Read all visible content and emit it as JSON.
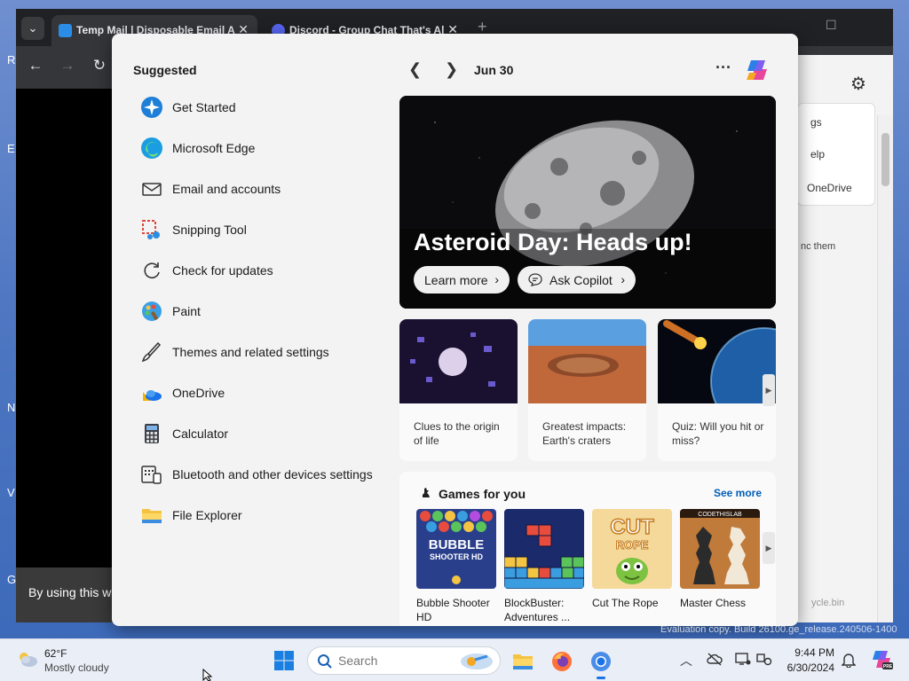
{
  "browser": {
    "tabs": [
      {
        "title": "Temp Mail | Disposable Email A",
        "active": true
      },
      {
        "title": "Discord - Group Chat That's Al",
        "active": false
      }
    ],
    "cookie_text": "By using this w",
    "side_menu": {
      "items": [
        "gs",
        "elp",
        "OneDrive"
      ],
      "text": "nc them",
      "recycle": "ycle.bin"
    }
  },
  "start_menu": {
    "suggested_heading": "Suggested",
    "apps": [
      {
        "label": "Get Started",
        "icon": "get-started-icon"
      },
      {
        "label": "Microsoft Edge",
        "icon": "edge-icon"
      },
      {
        "label": "Email and accounts",
        "icon": "mail-icon"
      },
      {
        "label": "Snipping Tool",
        "icon": "snipping-tool-icon"
      },
      {
        "label": "Check for updates",
        "icon": "refresh-icon"
      },
      {
        "label": "Paint",
        "icon": "paint-icon"
      },
      {
        "label": "Themes and related settings",
        "icon": "brush-icon"
      },
      {
        "label": "OneDrive",
        "icon": "onedrive-icon"
      },
      {
        "label": "Calculator",
        "icon": "calculator-icon"
      },
      {
        "label": "Bluetooth and other devices settings",
        "icon": "devices-icon"
      },
      {
        "label": "File Explorer",
        "icon": "folder-icon"
      }
    ],
    "date": "Jun 30",
    "hero": {
      "title": "Asteroid Day: Heads up!",
      "learn_more": "Learn more",
      "ask_copilot": "Ask Copilot"
    },
    "cards": [
      {
        "text": "Clues to the origin of life"
      },
      {
        "text": "Greatest impacts: Earth's craters"
      },
      {
        "text": "Quiz: Will you hit or miss?"
      }
    ],
    "games": {
      "heading": "Games for you",
      "see_more": "See more",
      "items": [
        {
          "name": "Bubble Shooter HD",
          "thumb_text": "BUBBLE SHOOTER HD"
        },
        {
          "name": "BlockBuster: Adventures ...",
          "thumb_text": ""
        },
        {
          "name": "Cut The Rope",
          "thumb_text": "CUT the ROPE"
        },
        {
          "name": "Master Chess",
          "thumb_text": "CODETHISLAB"
        }
      ]
    }
  },
  "taskbar": {
    "weather_temp": "62°F",
    "weather_condition": "Mostly cloudy",
    "search_placeholder": "Search",
    "time": "9:44 PM",
    "date": "6/30/2024"
  },
  "watermark": "Evaluation copy. Build 26100.ge_release.240506-1400",
  "colors": {
    "accent": "#005fb8",
    "taskbar": "#eaeef6",
    "start_bg": "#f3f3f3"
  }
}
